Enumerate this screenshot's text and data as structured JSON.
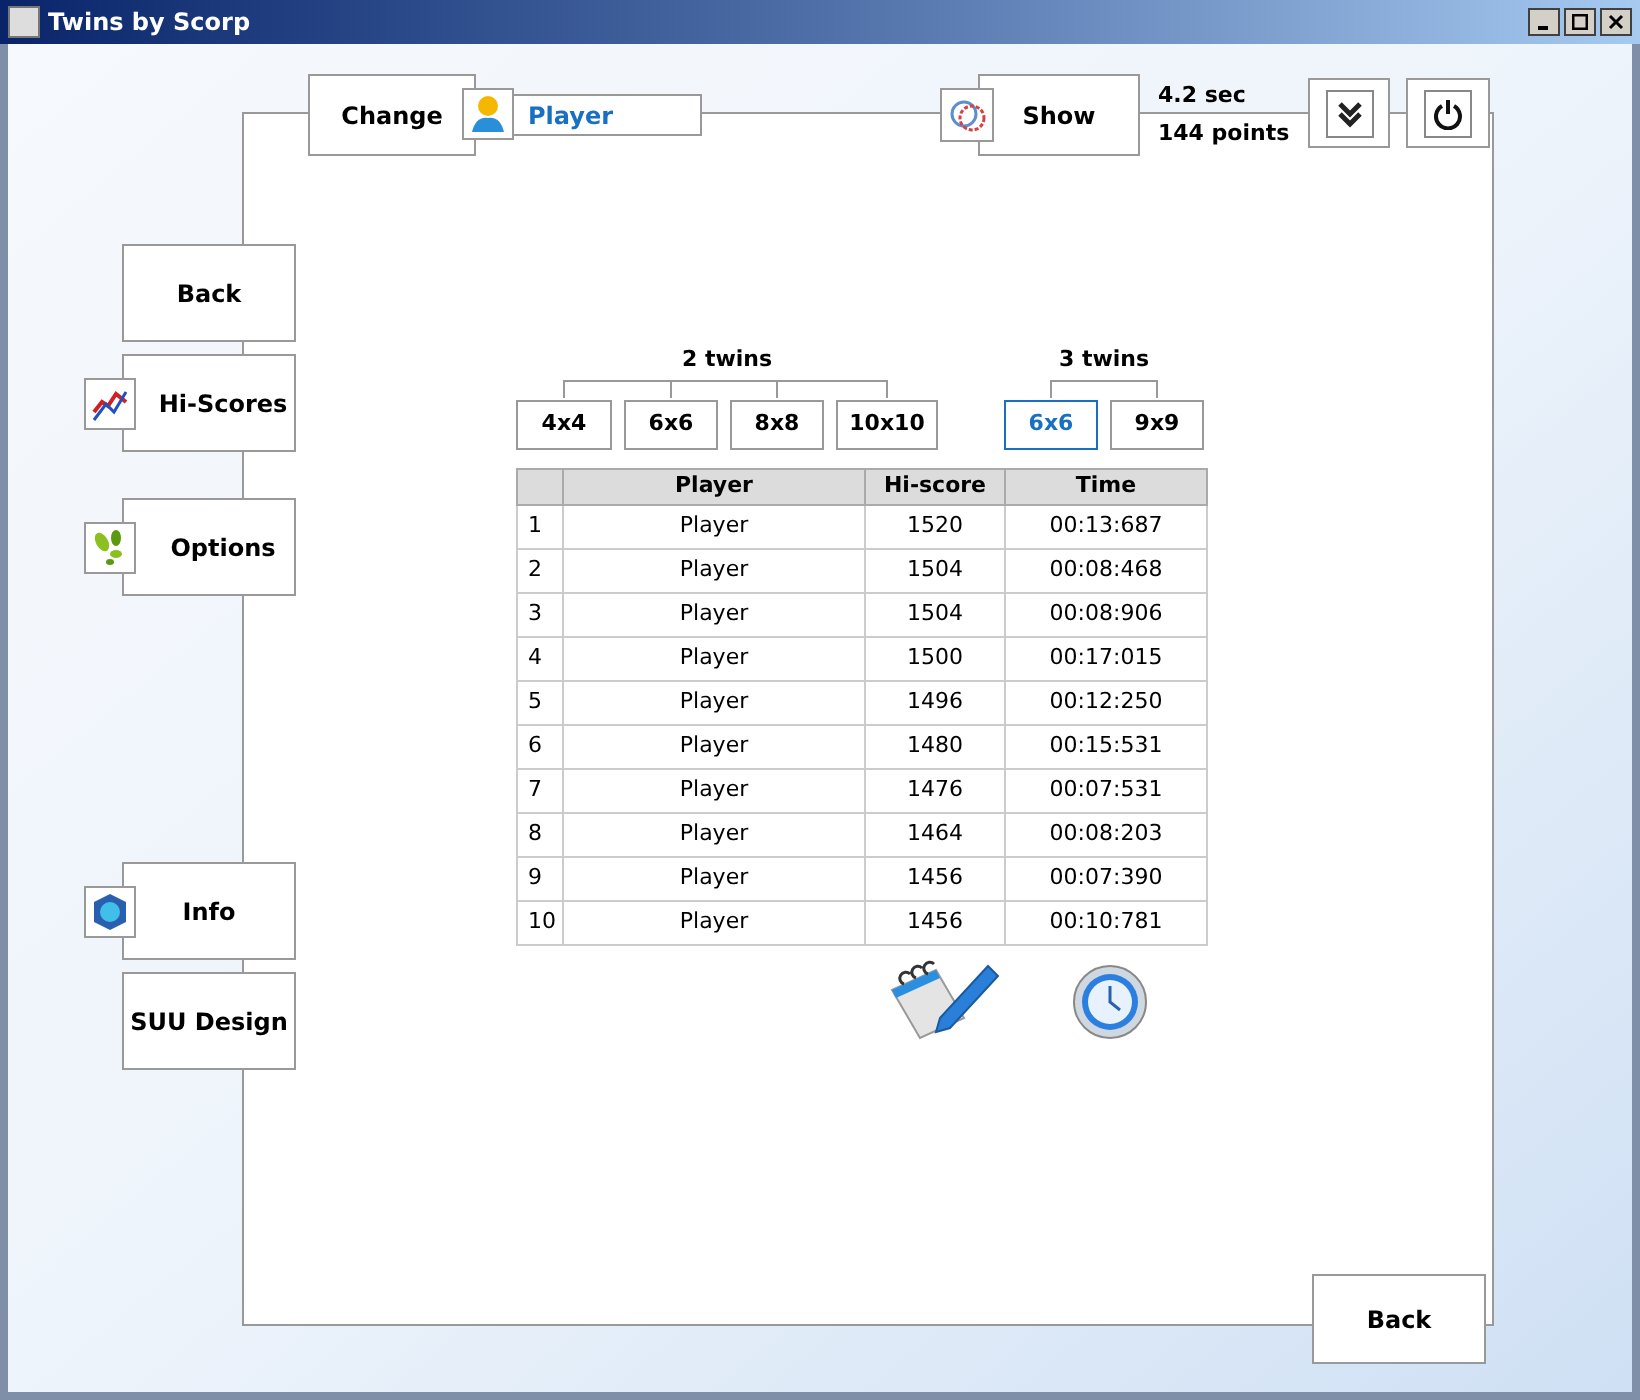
{
  "window": {
    "title": "Twins by Scorp"
  },
  "top": {
    "change_button": "Change",
    "player_name": "Player",
    "show_button": "Show",
    "time": "4.2 sec",
    "points": "144 points"
  },
  "side": {
    "back": "Back",
    "hi_scores": "Hi-Scores",
    "options": "Options",
    "info": "Info",
    "design": "SUU Design"
  },
  "groups": [
    {
      "label": "2 twins",
      "sizes": [
        {
          "label": "4x4",
          "selected": false
        },
        {
          "label": "6x6",
          "selected": false
        },
        {
          "label": "8x8",
          "selected": false
        },
        {
          "label": "10x10",
          "selected": false
        }
      ]
    },
    {
      "label": "3 twins",
      "sizes": [
        {
          "label": "6x6",
          "selected": true
        },
        {
          "label": "9x9",
          "selected": false
        }
      ]
    }
  ],
  "table": {
    "columns": [
      "",
      "Player",
      "Hi-score",
      "Time"
    ],
    "rows": [
      [
        "1",
        "Player",
        "1520",
        "00:13:687"
      ],
      [
        "2",
        "Player",
        "1504",
        "00:08:468"
      ],
      [
        "3",
        "Player",
        "1504",
        "00:08:906"
      ],
      [
        "4",
        "Player",
        "1500",
        "00:17:015"
      ],
      [
        "5",
        "Player",
        "1496",
        "00:12:250"
      ],
      [
        "6",
        "Player",
        "1480",
        "00:15:531"
      ],
      [
        "7",
        "Player",
        "1476",
        "00:07:531"
      ],
      [
        "8",
        "Player",
        "1464",
        "00:08:203"
      ],
      [
        "9",
        "Player",
        "1456",
        "00:07:390"
      ],
      [
        "10",
        "Player",
        "1456",
        "00:10:781"
      ]
    ]
  },
  "bottom": {
    "back": "Back"
  }
}
